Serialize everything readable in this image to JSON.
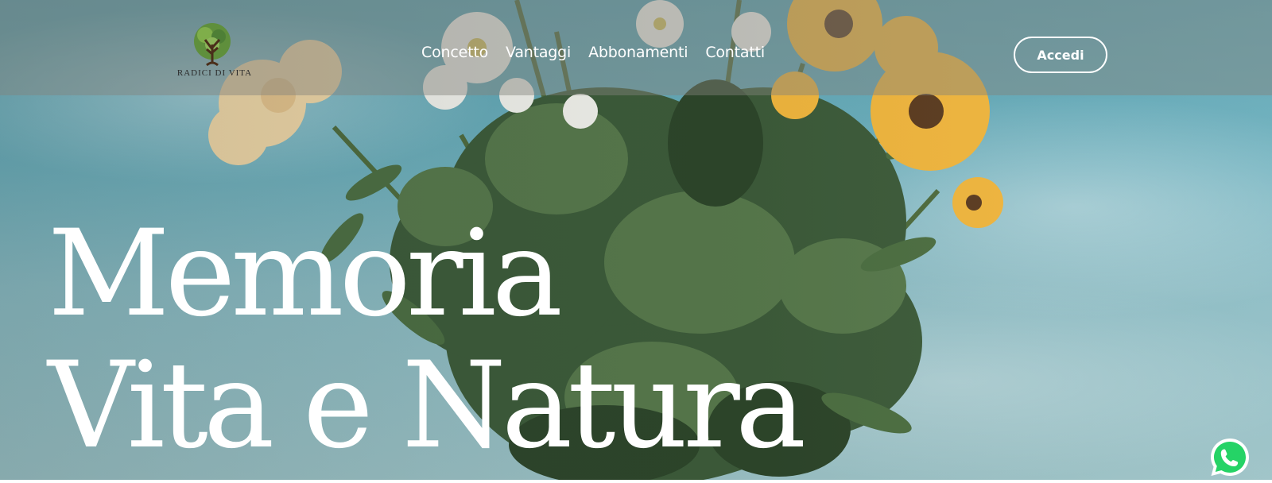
{
  "brand": {
    "logo_text": "RADICI DI VITA",
    "logo_icon": "tree-logo-icon"
  },
  "nav": {
    "items": [
      {
        "label": "Concetto"
      },
      {
        "label": "Vantaggi"
      },
      {
        "label": "Abbonamenti"
      },
      {
        "label": "Contatti"
      }
    ]
  },
  "header": {
    "login_label": "Accedi"
  },
  "hero": {
    "line1": "Memoria",
    "line2": "Vita e Natura",
    "background": "flower-bouquet-sky-photo"
  },
  "floating": {
    "whatsapp_icon": "whatsapp-icon"
  },
  "colors": {
    "sky": "#6eb0bd",
    "text": "#ffffff",
    "foliage": "#3c5a38",
    "flower_yellow": "#f2b63c",
    "flower_cream": "#f4d9a8",
    "whatsapp_green": "#25d366"
  }
}
